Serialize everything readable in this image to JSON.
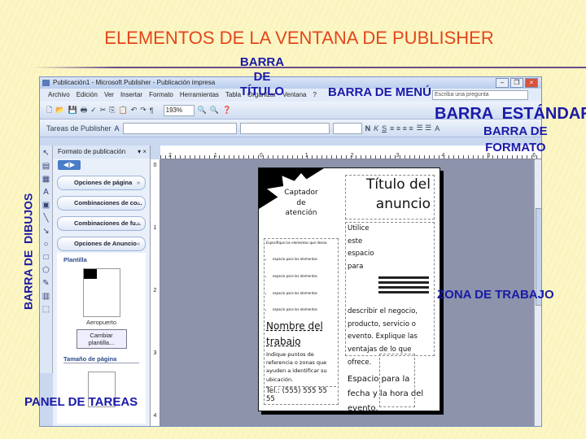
{
  "slide": {
    "title": "ELEMENTOS DE LA VENTANA DE PUBLISHER",
    "labels": {
      "titulo": [
        "BARRA",
        "DE",
        "TÍTULO"
      ],
      "menu": "BARRA DE MENÚ",
      "estandar": "BARRA  ESTÁNDAR",
      "formato": [
        "BARRA DE",
        "FORMATO"
      ],
      "dibujos": "BARRA DE  DIBUJOS",
      "trabajo": "ZONA DE TRABAJO",
      "tareas": "PANEL DE TAREAS"
    }
  },
  "window": {
    "title": "Publicación1 - Microsoft Publisher - Publicación impresa",
    "menu": [
      "Archivo",
      "Edición",
      "Ver",
      "Insertar",
      "Formato",
      "Herramientas",
      "Tabla",
      "Organizar",
      "Ventana",
      "?"
    ],
    "ask_placeholder": "Escriba una pregunta",
    "zoom": "193%",
    "tasks_button": "Tareas de Publisher"
  },
  "task_pane": {
    "title": "Formato de publicación",
    "sections": [
      "Opciones de página",
      "Combinaciones de co...",
      "Combinaciones de fu...",
      "Opciones de Anuncio"
    ],
    "template_heading": "Plantilla",
    "template_name": "Aeropuerto",
    "change_template": "Cambiar plantilla...",
    "page_size_heading": "Tamaño de página"
  },
  "rulers": {
    "h": [
      "2",
      "1",
      "0",
      "1",
      "2",
      "3",
      "4",
      "5",
      "6"
    ],
    "v": [
      "0",
      "1",
      "2",
      "3",
      "4"
    ]
  },
  "page": {
    "burst": "Captador de atención",
    "title": "Título del anuncio",
    "small_heading": "Especifique los elementos que desea.",
    "bullets": [
      "espacio para los elementos",
      "espacio para los elementos",
      "espacio para los elementos",
      "espacio para los elementos"
    ],
    "job_name": "Nombre del trabajo",
    "location": "Indique puntos de referencia o zonas que ayuden a identificar su ubicación.",
    "phone": "Tel.: (555) 555 55 55",
    "description": "Utilice este espacio para describir el negocio, producto, servicio o evento. Explique las ventajas de lo que ofrece.",
    "date": "Espacio para la fecha y la hora del evento."
  }
}
